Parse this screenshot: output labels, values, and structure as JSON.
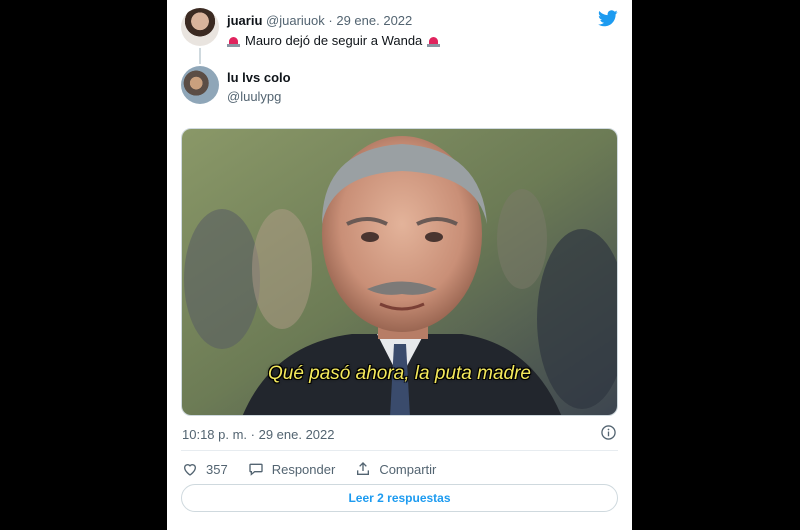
{
  "tweet": {
    "author_name": "juariu",
    "author_handle": "@juariuok",
    "separator": "·",
    "date": "29 ene. 2022",
    "text": "Mauro dejó de seguir a Wanda",
    "emoji_icon": "police-siren-icon"
  },
  "reply": {
    "author_name": "lu lvs colo",
    "author_handle": "@luulypg",
    "media_caption": "Qué pasó ahora, la puta madre",
    "timestamp": "10:18 p. m. · 29 ene. 2022"
  },
  "actions": {
    "like_count": "357",
    "reply_label": "Responder",
    "share_label": "Compartir"
  },
  "read_replies_label": "Leer 2 respuestas",
  "colors": {
    "twitter_blue": "#1d9bf0",
    "text_secondary": "#536471",
    "caption_yellow": "#f4e95c"
  }
}
